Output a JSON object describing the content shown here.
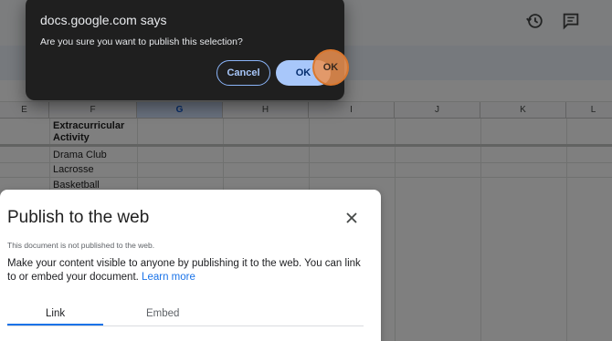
{
  "confirm_dialog": {
    "title": "docs.google.com says",
    "message": "Are you sure you want to publish this selection?",
    "cancel_label": "Cancel",
    "ok_label": "OK"
  },
  "sheet": {
    "column_headers": [
      "E",
      "F",
      "G",
      "H",
      "I",
      "J",
      "K",
      "L"
    ],
    "selected_column": "G",
    "header_cell_line1": "Extracurricular",
    "header_cell_line2": "Activity",
    "rows": [
      "Drama Club",
      "Lacrosse",
      "Basketball"
    ]
  },
  "publish_dialog": {
    "title": "Publish to the web",
    "status": "This document is not published to the web.",
    "description": "Make your content visible to anyone by publishing it to the web. You can link to or embed your document.",
    "learn_more": "Learn more",
    "tabs": [
      "Link",
      "Embed"
    ],
    "active_tab": "Link"
  },
  "icons": {
    "history": "history-icon",
    "comment": "comment-icon",
    "close": "close-icon"
  },
  "colors": {
    "accent": "#1a73e8",
    "ok_button": "#a8c7fa",
    "dialog_bg": "#1f1f1f",
    "click_marker": "#ec9050"
  }
}
